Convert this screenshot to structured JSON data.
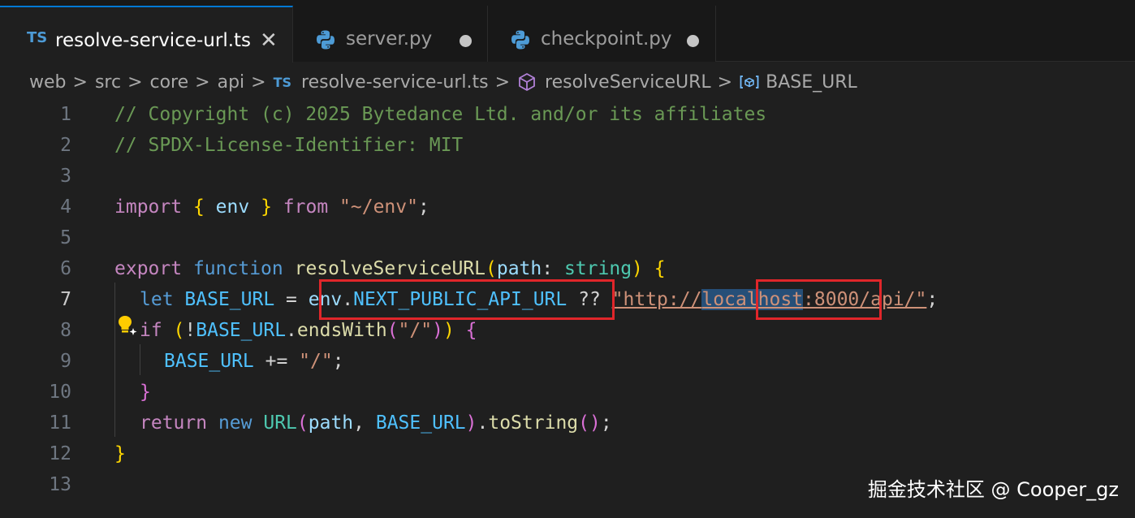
{
  "tabs": [
    {
      "icon": "typescript-icon",
      "badge": "TS",
      "label": "resolve-service-url.ts",
      "active": true,
      "close": "✕"
    },
    {
      "icon": "python-icon",
      "label": "server.py",
      "active": false
    },
    {
      "icon": "python-icon",
      "label": "checkpoint.py",
      "active": false
    }
  ],
  "breadcrumb": {
    "parts": [
      "web",
      "src",
      "core",
      "api"
    ],
    "file_badge": "TS",
    "file": "resolve-service-url.ts",
    "function": "resolveServiceURL",
    "variable": "BASE_URL",
    "separator": ">"
  },
  "editor": {
    "current_line": 7,
    "line_numbers": [
      "1",
      "2",
      "3",
      "4",
      "5",
      "6",
      "7",
      "8",
      "9",
      "10",
      "11",
      "12",
      "13"
    ],
    "lines": {
      "l1": "// Copyright (c) 2025 Bytedance Ltd. and/or its affiliates",
      "l2": "// SPDX-License-Identifier: MIT",
      "l4": {
        "import": "import",
        "brace_open": "{",
        "env": "env",
        "brace_close": "}",
        "from": "from",
        "module": "\"~/env\"",
        "semi": ";"
      },
      "l6": {
        "export": "export",
        "function": "function",
        "name": "resolveServiceURL",
        "paren_open": "(",
        "param": "path",
        "colon": ": ",
        "type": "string",
        "paren_close": ")",
        "brace": "{"
      },
      "l7": {
        "let": "let",
        "var": "BASE_URL",
        "eq": " = ",
        "env": "env",
        "dot": ".",
        "prop": "NEXT_PUBLIC_API_URL",
        "nullish": " ?? ",
        "str_a": "\"http://",
        "str_sel": "localhost",
        "str_b": ":8000/api/\"",
        "semi": ";"
      },
      "l8": {
        "if": "if",
        "paren_open": " (",
        "not": "!",
        "var": "BASE_URL",
        "dot": ".",
        "method": "endsWith",
        "p_open": "(",
        "arg": "\"/\"",
        "p_close": ")",
        "paren_close": ")",
        "brace": "{"
      },
      "l9": {
        "var": "BASE_URL",
        "op": " += ",
        "str": "\"/\"",
        "semi": ";"
      },
      "l10": {
        "brace": "}"
      },
      "l11": {
        "return": "return",
        "new": "new",
        "cls": "URL",
        "p_open": "(",
        "arg1": "path",
        "comma": ", ",
        "arg2": "BASE_URL",
        "p_close": ")",
        "dot": ".",
        "method": "toString",
        "call": "()",
        "semi": ";"
      },
      "l12": {
        "brace": "}"
      }
    }
  },
  "watermark": "掘金技术社区 @ Cooper_gz",
  "colors": {
    "background": "#1f1f1f",
    "tab_accent": "#0078d4",
    "annotation_box": "#e0262a",
    "selection": "#264f78"
  }
}
